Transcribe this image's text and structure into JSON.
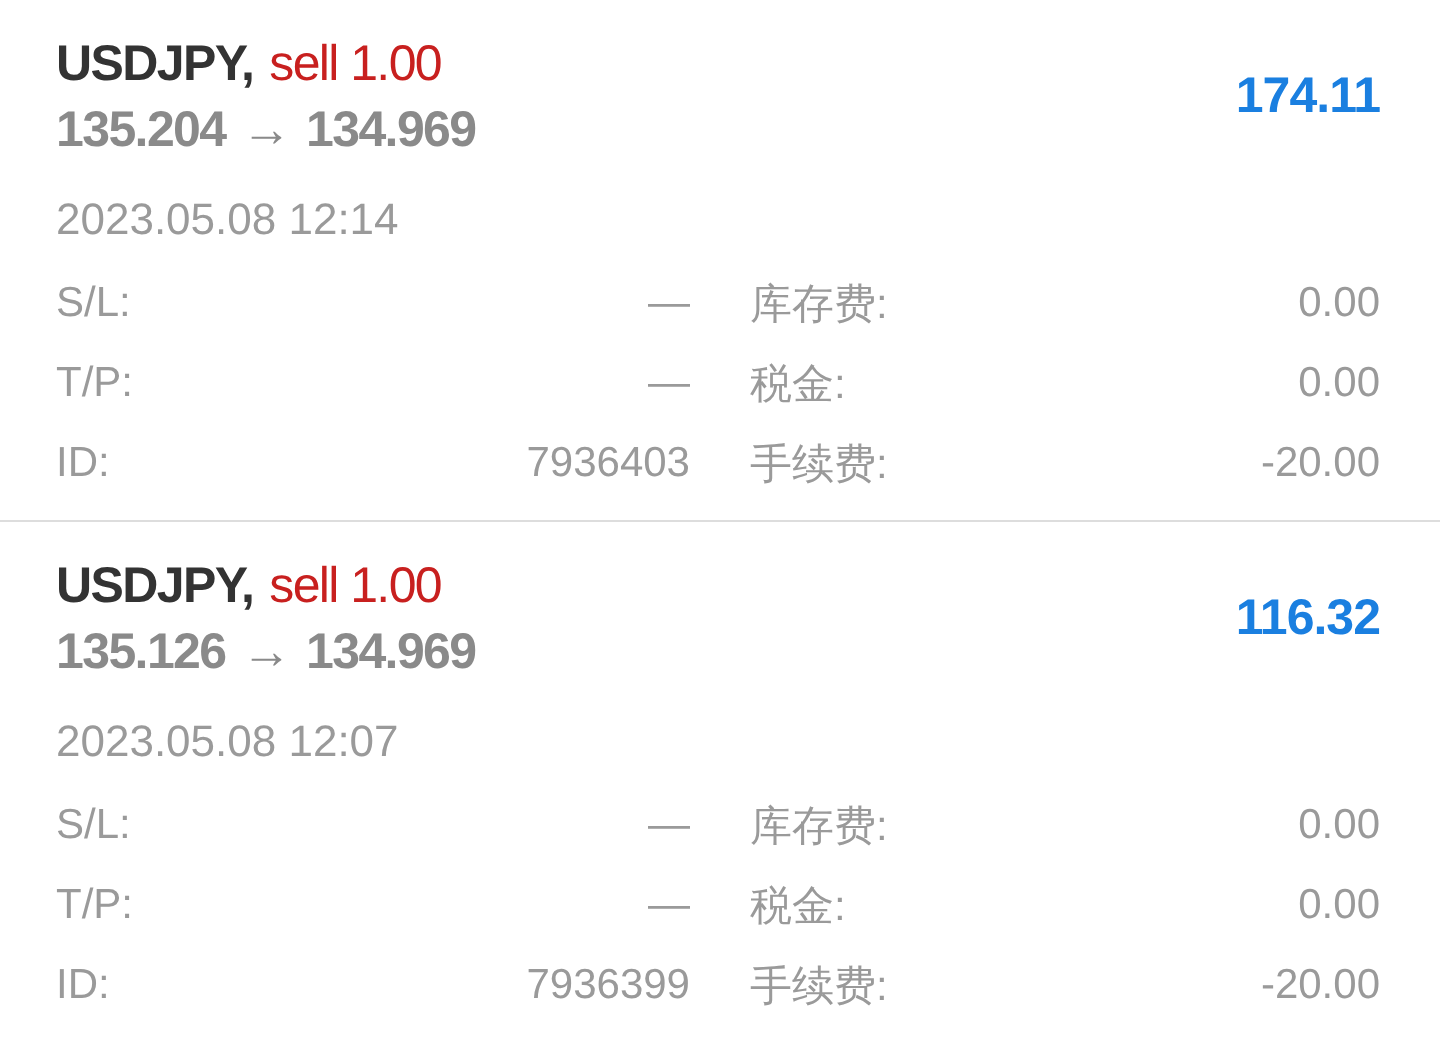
{
  "trades": [
    {
      "symbol": "USDJPY,",
      "side": "sell 1.00",
      "open_price": "135.204",
      "arrow": "→",
      "close_price": "134.969",
      "profit": "174.11",
      "time": "2023.05.08 12:14",
      "rows": [
        {
          "label": "S/L:",
          "value": "—",
          "label_2": "库存费:",
          "value_2": "0.00"
        },
        {
          "label": "T/P:",
          "value": "—",
          "label_2": "税金:",
          "value_2": "0.00"
        },
        {
          "label": "ID:",
          "value": "7936403",
          "label_2": "手续费:",
          "value_2": "-20.00"
        }
      ]
    },
    {
      "symbol": "USDJPY,",
      "side": "sell 1.00",
      "open_price": "135.126",
      "arrow": "→",
      "close_price": "134.969",
      "profit": "116.32",
      "time": "2023.05.08 12:07",
      "rows": [
        {
          "label": "S/L:",
          "value": "—",
          "label_2": "库存费:",
          "value_2": "0.00"
        },
        {
          "label": "T/P:",
          "value": "—",
          "label_2": "税金:",
          "value_2": "0.00"
        },
        {
          "label": "ID:",
          "value": "7936399",
          "label_2": "手续费:",
          "value_2": "-20.00"
        }
      ]
    }
  ]
}
